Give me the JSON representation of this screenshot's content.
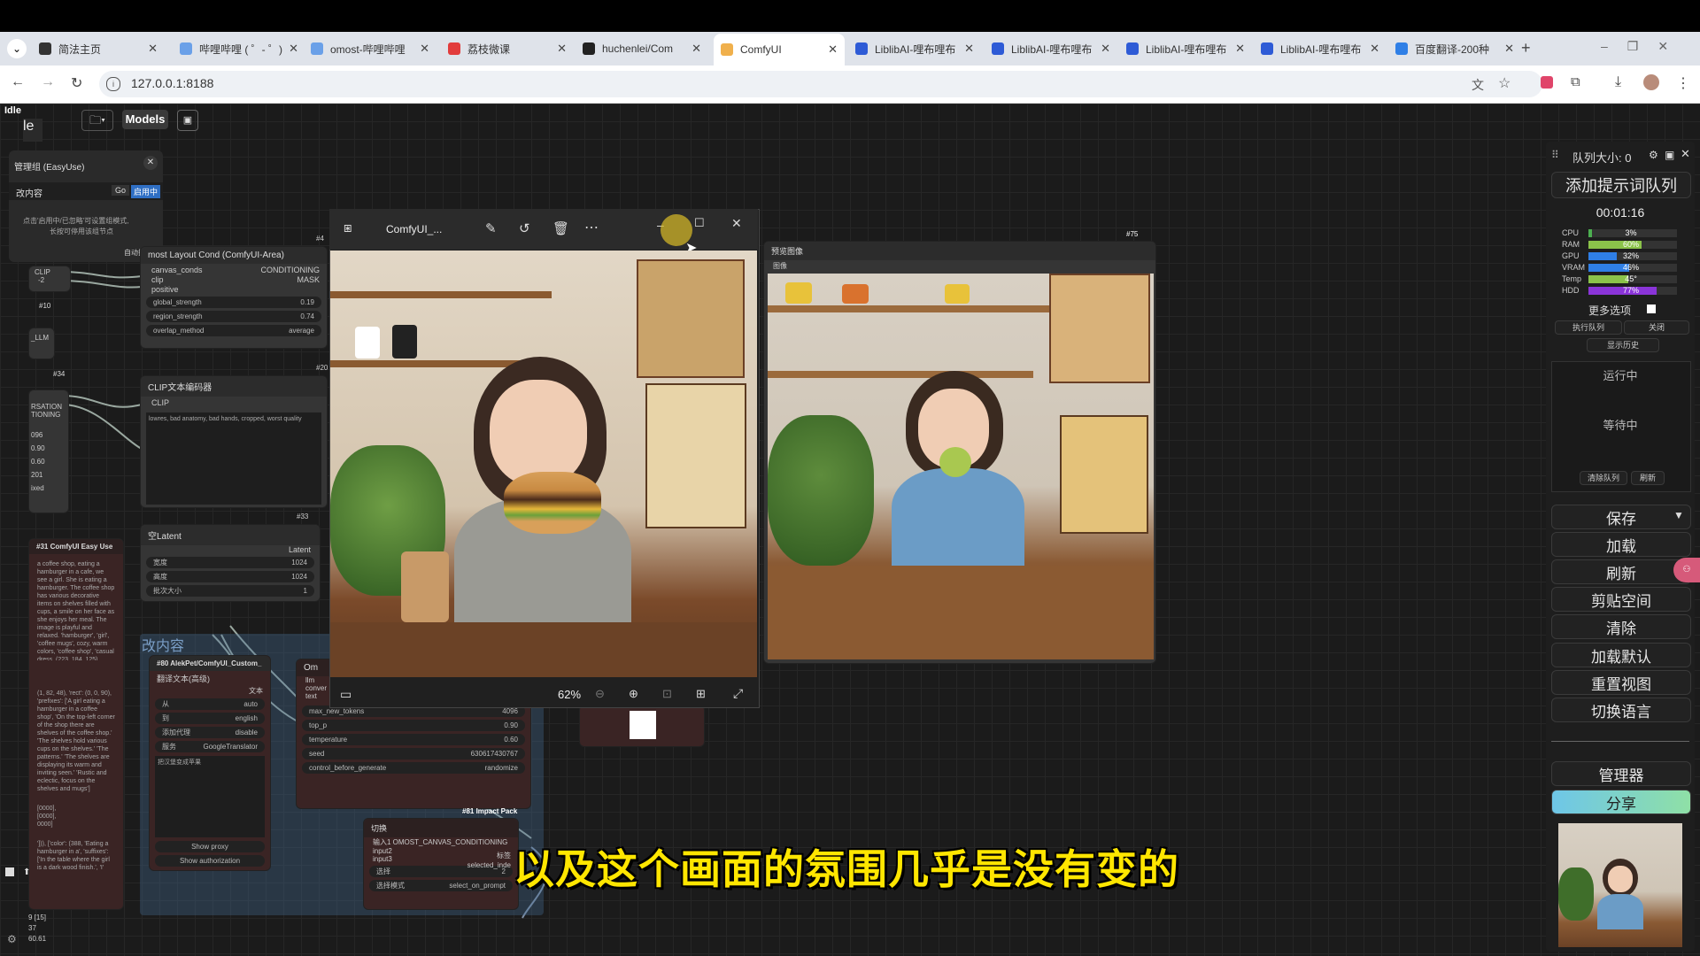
{
  "browser": {
    "tabs": [
      {
        "title": "简法主页",
        "color": "#333333"
      },
      {
        "title": "哔哩哔哩 ( ゜- ゜)",
        "color": "#6aa0e8"
      },
      {
        "title": "omost-哔哩哔哩",
        "color": "#6aa0e8"
      },
      {
        "title": "荔枝微课",
        "color": "#e23c3c"
      },
      {
        "title": "huchenlei/Com",
        "color": "#222222"
      },
      {
        "title": "ComfyUI",
        "color": "#f0b04c"
      },
      {
        "title": "LiblibAI-哩布哩布",
        "color": "#2e5bd6"
      },
      {
        "title": "LiblibAI-哩布哩布",
        "color": "#2e5bd6"
      },
      {
        "title": "LiblibAI-哩布哩布",
        "color": "#2e5bd6"
      },
      {
        "title": "LiblibAI-哩布哩布",
        "color": "#2e5bd6"
      },
      {
        "title": "百度翻译-200种",
        "color": "#2f7fe6"
      }
    ],
    "url": "127.0.0.1:8188"
  },
  "app": {
    "status": "Idle",
    "models_button": "Models",
    "idle_partial": "le",
    "group_manager": {
      "title": "管理组 (EasyUse)",
      "group_name": "改内容",
      "go_label": "Go",
      "enable_label": "启用中",
      "hint_line1": "点击'启用中/已忽略'可设置组模式,",
      "hint_line2": "长按可停用该组节点",
      "auto_sort": "自动排序"
    },
    "canvas_group_label": "改内容",
    "nodes": {
      "layout_cond": {
        "title": "most Layout Cond (ComfyUI-Area)",
        "id": "#4",
        "inputs": [
          "canvas_conds",
          "clip",
          "positive"
        ],
        "outputs": [
          "CONDITIONING",
          "MASK"
        ],
        "widgets": [
          {
            "label": "global_strength",
            "value": "0.19"
          },
          {
            "label": "region_strength",
            "value": "0.74"
          },
          {
            "label": "overlap_method",
            "value": "average"
          }
        ]
      },
      "clip_encoder": {
        "title": "CLIP文本编码器",
        "id": "#20",
        "input": "CLIP",
        "text": "lowres, bad anatomy, bad hands, cropped, worst quality"
      },
      "empty_latent": {
        "title": "空Latent",
        "id": "#33",
        "output": "Latent",
        "widgets": [
          {
            "label": "宽度",
            "value": "1024"
          },
          {
            "label": "高度",
            "value": "1024"
          },
          {
            "label": "批次大小",
            "value": "1"
          }
        ]
      },
      "left_stub": {
        "labels": [
          "CLIP",
          "-2",
          "#10",
          "_LLM",
          "#34",
          "RSATION",
          "TIONING"
        ],
        "values": [
          "096",
          "0.90",
          "0.60",
          "201",
          "ixed"
        ]
      },
      "easy_use": {
        "title": "#31 ComfyUI Easy Use",
        "text_a": "a coffee shop, eating a hamburger in a cafe, we see a girl. She is eating a hamburger. The coffee shop has various decorative items on shelves filled with cups, a smile on her face as she enjoys her meal. The image is playful and relaxed. 'hamburger', 'girl', 'coffee mugs', cozy, warm colors, 'coffee shop', 'casual dress, (223, 184, 125).",
        "text_b": "(1, 82, 48), 'rect': (0, 0, 90), 'prefixes': ['A girl eating a hamburger in a coffee shop', 'On the top-left corner of the shop there are shelves of the coffee shop.' 'The shelves hold various cups on the shelves.' 'The patterns.' 'The shelves are displaying its warm and inviting seen.' 'Rustic and eclectic, focus on the shelves and mugs']",
        "text_c": "[0000],\n[0000],\n0000]",
        "text_d": "'])), ['color': (388, 'Eating a hamburger in a', 'suffixes': ['In the table where the girl is a dark wood finish.', 'I'",
        "footer1": "9 [15]",
        "footer2": "37",
        "footer3": "60.61"
      },
      "translate": {
        "title": "#80 AlekPet/ComfyUI_Custom_",
        "subtitle": "翻译文本(高级)",
        "output": "文本",
        "widgets": [
          {
            "label": "从",
            "value": "auto"
          },
          {
            "label": "到",
            "value": "english"
          },
          {
            "label": "添加代理",
            "value": "disable"
          },
          {
            "label": "服务",
            "value": "GoogleTranslator"
          }
        ],
        "text": "把汉堡变成苹果",
        "button1": "Show proxy",
        "button2": "Show authorization"
      },
      "omost_llm": {
        "title": "Om",
        "inputs": [
          "llm",
          "conver",
          "text"
        ],
        "widgets": [
          {
            "label": "max_new_tokens",
            "value": "4096"
          },
          {
            "label": "top_p",
            "value": "0.90"
          },
          {
            "label": "temperature",
            "value": "0.60"
          },
          {
            "label": "seed",
            "value": "630617430767"
          },
          {
            "label": "control_before_generate",
            "value": "randomize"
          }
        ]
      },
      "impact": {
        "title": "#81 Impact Pack",
        "subtitle": "切换",
        "inputs": [
          "输入1 OMOST_CANVAS_CONDITIONING",
          "input2",
          "input3"
        ],
        "right_labels": [
          "标签",
          "selected_inde"
        ],
        "widgets": [
          {
            "label": "选择",
            "value": "2"
          },
          {
            "label": "选择模式",
            "value": "select_on_prompt"
          }
        ]
      },
      "preview": {
        "id": "#75",
        "title": "预览图像",
        "input": "图像"
      }
    },
    "viewer": {
      "title": "ComfyUI_...",
      "zoom": "62%"
    },
    "right_panel": {
      "queue_size": "队列大小: 0",
      "add_prompt": "添加提示词队列",
      "timer": "00:01:16",
      "meters": [
        {
          "label": "CPU",
          "value": "3%",
          "level": 0.03,
          "color": "#4caf50"
        },
        {
          "label": "RAM",
          "value": "60%",
          "level": 0.6,
          "color": "#8bc34a"
        },
        {
          "label": "GPU",
          "value": "32%",
          "level": 0.32,
          "color": "#2f7fe6"
        },
        {
          "label": "VRAM",
          "value": "46%",
          "level": 0.46,
          "color": "#2f7fe6"
        },
        {
          "label": "Temp",
          "value": "45°",
          "level": 0.45,
          "color": "#8bc34a"
        },
        {
          "label": "HDD",
          "value": "77%",
          "level": 0.77,
          "color": "#8a34d8"
        }
      ],
      "more_options": "更多选项",
      "run_queue": "执行队列",
      "close": "关闭",
      "show_history": "显示历史",
      "running": "运行中",
      "waiting": "等待中",
      "clear_queue": "清除队列",
      "refresh_small": "刷新",
      "save": "保存",
      "load": "加载",
      "refresh": "刷新",
      "clipspace": "剪贴空间",
      "clear": "清除",
      "load_default": "加载默认",
      "reset_view": "重置视图",
      "switch_lang": "切换语言",
      "manager": "管理器",
      "share": "分享"
    }
  },
  "subtitle": "以及这个画面的氛围几乎是没有变的"
}
